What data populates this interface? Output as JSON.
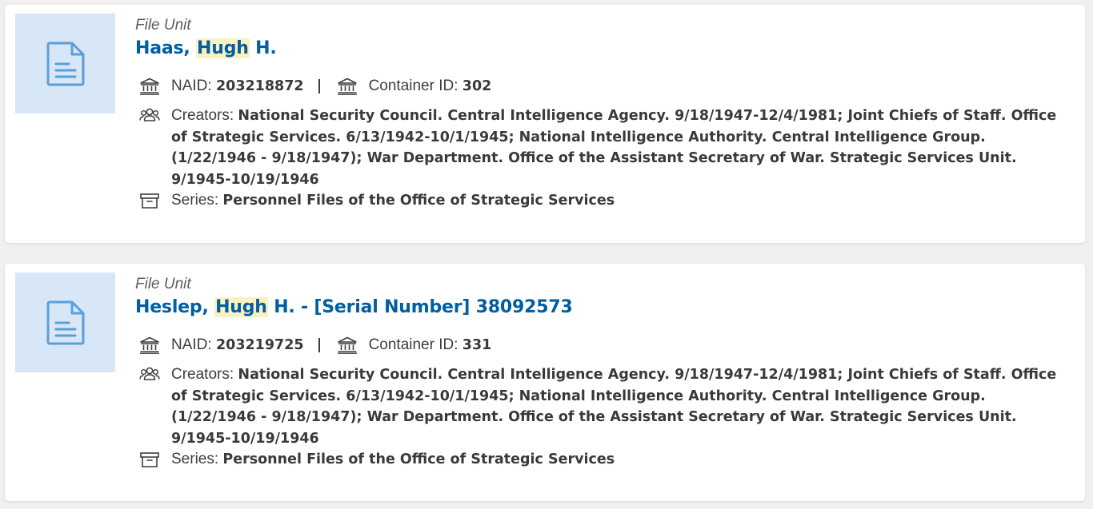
{
  "results": [
    {
      "type": "File Unit",
      "title_before": "Haas, ",
      "title_highlight": "Hugh",
      "title_after": " H.",
      "naid_label": "NAID:",
      "naid": "203218872",
      "container_label": "Container ID:",
      "container_id": "302",
      "creators_label": "Creators:",
      "creators": "National Security Council. Central Intelligence Agency. 9/18/1947-12/4/1981; Joint Chiefs of Staff. Office of Strategic Services. 6/13/1942-10/1/1945; National Intelligence Authority. Central Intelligence Group. (1/22/1946 - 9/18/1947); War Department. Office of the Assistant Secretary of War. Strategic Services Unit. 9/1945-10/19/1946",
      "series_label": "Series:",
      "series": "Personnel Files of the Office of Strategic Services"
    },
    {
      "type": "File Unit",
      "title_before": "Heslep, ",
      "title_highlight": "Hugh",
      "title_after": " H. - [Serial Number] 38092573",
      "naid_label": "NAID:",
      "naid": "203219725",
      "container_label": "Container ID:",
      "container_id": "331",
      "creators_label": "Creators:",
      "creators": "National Security Council. Central Intelligence Agency. 9/18/1947-12/4/1981; Joint Chiefs of Staff. Office of Strategic Services. 6/13/1942-10/1/1945; National Intelligence Authority. Central Intelligence Group. (1/22/1946 - 9/18/1947); War Department. Office of the Assistant Secretary of War. Strategic Services Unit. 9/1945-10/19/1946",
      "series_label": "Series:",
      "series": "Personnel Files of the Office of Strategic Services"
    }
  ],
  "icons": {
    "thumbnail": "document-icon",
    "naid": "building-icon",
    "container": "building-icon",
    "creators": "people-icon",
    "series": "archive-box-icon"
  },
  "colors": {
    "title": "#005ea2",
    "highlight": "#fdf2bf",
    "thumbnail_bg": "#d7e7f7",
    "thumbnail_icon": "#5b9fd9"
  }
}
